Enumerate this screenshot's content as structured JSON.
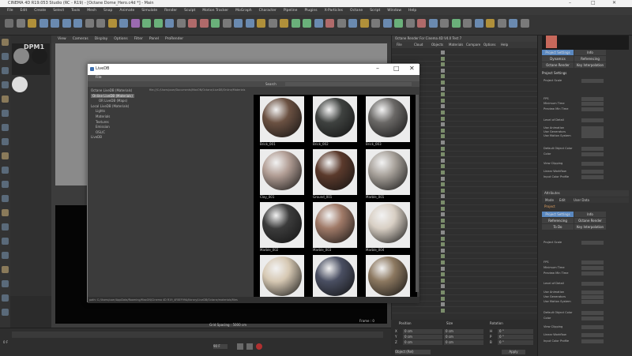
{
  "window": {
    "title": "CINEMA 4D R19.053 Studio (RC - R19) - [Octane Dome_Hero.c4d *] - Main",
    "time": "22:14"
  },
  "menubar": [
    "File",
    "Edit",
    "Create",
    "Select",
    "Tools",
    "Mesh",
    "Snap",
    "Animate",
    "Simulate",
    "Render",
    "Sculpt",
    "Motion Tracker",
    "MoGraph",
    "Character",
    "Pipeline",
    "Plugins",
    "X-Particles",
    "Octane",
    "Script",
    "Window",
    "Help"
  ],
  "viewport": {
    "menu": [
      "View",
      "Cameras",
      "Display",
      "Options",
      "Filter",
      "Panel",
      "ProRender"
    ],
    "status": [
      "Grid Spacing : 5000 cm",
      "Frame : 0"
    ]
  },
  "octane": {
    "title": "Octane Render For Cinema 4D V4.0 Test 7",
    "menu": [
      "File",
      "Cloud",
      "Objects",
      "Materials",
      "Compare",
      "Options",
      "Help"
    ]
  },
  "attributes": {
    "tabs_top": [
      "Project Settings",
      "Info"
    ],
    "tabs_more": [
      "Dynamics",
      "Referencing",
      "Octane Render",
      "To Do",
      "Key Interpolation"
    ],
    "header": "Project Settings",
    "rows": [
      "Project Scale",
      "FPS",
      "Minimum Time",
      "Preview Min Time",
      "Level of Detail",
      "Use Animation",
      "Use Generators",
      "Use Motion System",
      "Default Object Color",
      "Color",
      "View Clipping",
      "Linear Workflow",
      "Input Color Profile"
    ],
    "section2_title": "Attributes",
    "section2_menu": [
      "Mode",
      "Edit",
      "User Data"
    ],
    "project_label": "Project"
  },
  "timeline": {
    "frame_label": "0 F",
    "end": "90 F",
    "buttons": [
      "play",
      "stop",
      "record"
    ]
  },
  "coordinates": {
    "headers": [
      "Position",
      "Size",
      "Rotation"
    ],
    "rows": [
      [
        "X",
        "0 cm",
        "0 cm",
        "H",
        "0 °"
      ],
      [
        "Y",
        "0 cm",
        "0 cm",
        "P",
        "0 °"
      ],
      [
        "Z",
        "0 cm",
        "0 cm",
        "B",
        "0 °"
      ]
    ],
    "object_mode": "Object (Rel)",
    "apply": "Apply"
  },
  "materials_panel": {
    "label": "DPM1"
  },
  "dialog": {
    "title": "LiveDB",
    "menu": [
      "File"
    ],
    "tree": [
      "Octane LiveDB (Materials)",
      "Online LiveDB (Materials)",
      "OR LiveDB (Maps)",
      "Local LiveDB (Materials)",
      "Lights",
      "Materials",
      "Textures",
      "Emission",
      "OSL/C",
      "LiveDB"
    ],
    "search_label": "Search",
    "selected_path": "file:///C:/Users/user/Documents/MaxON/Octane/LiveDB/Online/Materials",
    "materials": [
      {
        "name": "Brick_001",
        "color": "#6b5142"
      },
      {
        "name": "Brick_002",
        "color": "#3f4240"
      },
      {
        "name": "Brick_003",
        "color": "#6a6866"
      },
      {
        "name": "Clay_001",
        "color": "#b29e95"
      },
      {
        "name": "Ground_001",
        "color": "#5b3a2c"
      },
      {
        "name": "Marble_001",
        "color": "#a8a29b"
      },
      {
        "name": "Marble_002",
        "color": "#3c3c3c"
      },
      {
        "name": "Marble_003",
        "color": "#a07a68"
      },
      {
        "name": "Marble_004",
        "color": "#d8cfc4"
      },
      {
        "name": "Marble_005",
        "color": "#d6c8b3"
      },
      {
        "name": "Metal_001",
        "color": "#4a4f62"
      },
      {
        "name": "Rock_001",
        "color": "#8c7860"
      }
    ],
    "status": "path: C:/Users/user/AppData/Roaming/MaxON/Cinema 4D R19_4F8EF99A/library/LiveDB/Octane/materials/files"
  }
}
